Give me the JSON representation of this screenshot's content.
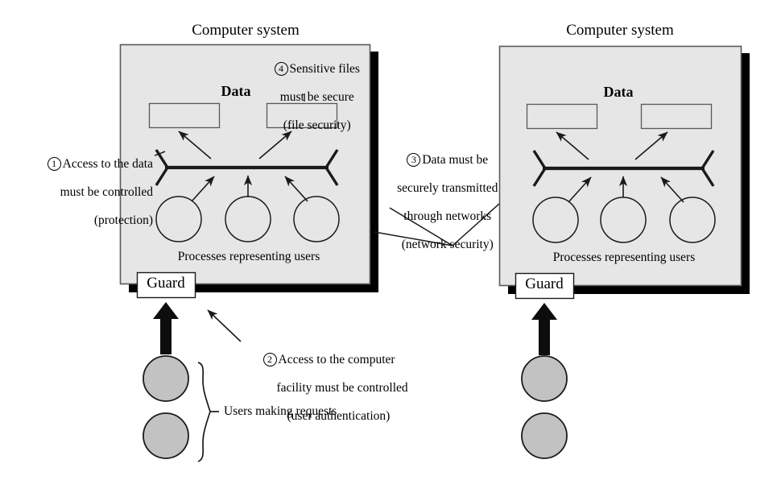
{
  "figure": {
    "panels": [
      {
        "id": "left",
        "title": "Computer system",
        "data_label": "Data",
        "processes_label": "Processes representing users",
        "guard_label": "Guard"
      },
      {
        "id": "right",
        "title": "Computer system",
        "data_label": "Data",
        "processes_label": "Processes representing users",
        "guard_label": "Guard"
      }
    ],
    "callouts": [
      {
        "number": "1",
        "lines": [
          "Access to the data",
          "must be controlled",
          "(protection)"
        ],
        "align": "right"
      },
      {
        "number": "2",
        "lines": [
          "Access to the computer",
          "facility must be controlled",
          "(user authentication)"
        ],
        "align": "left"
      },
      {
        "number": "3",
        "lines": [
          "Data must be",
          "securely transmitted",
          "through networks",
          "(network security)"
        ],
        "align": "center"
      },
      {
        "number": "4",
        "lines": [
          "Sensitive files",
          "must be secure",
          "(file security)"
        ],
        "align": "center"
      }
    ],
    "users_brace_label": "Users making requests",
    "colors": {
      "panel_fill": "#e6e6e6",
      "panel_stroke": "#595959",
      "shadow": "#000000",
      "user_circle_fill": "#c2c2c2",
      "stroke": "#1a1a1a",
      "background": "#ffffff"
    }
  }
}
